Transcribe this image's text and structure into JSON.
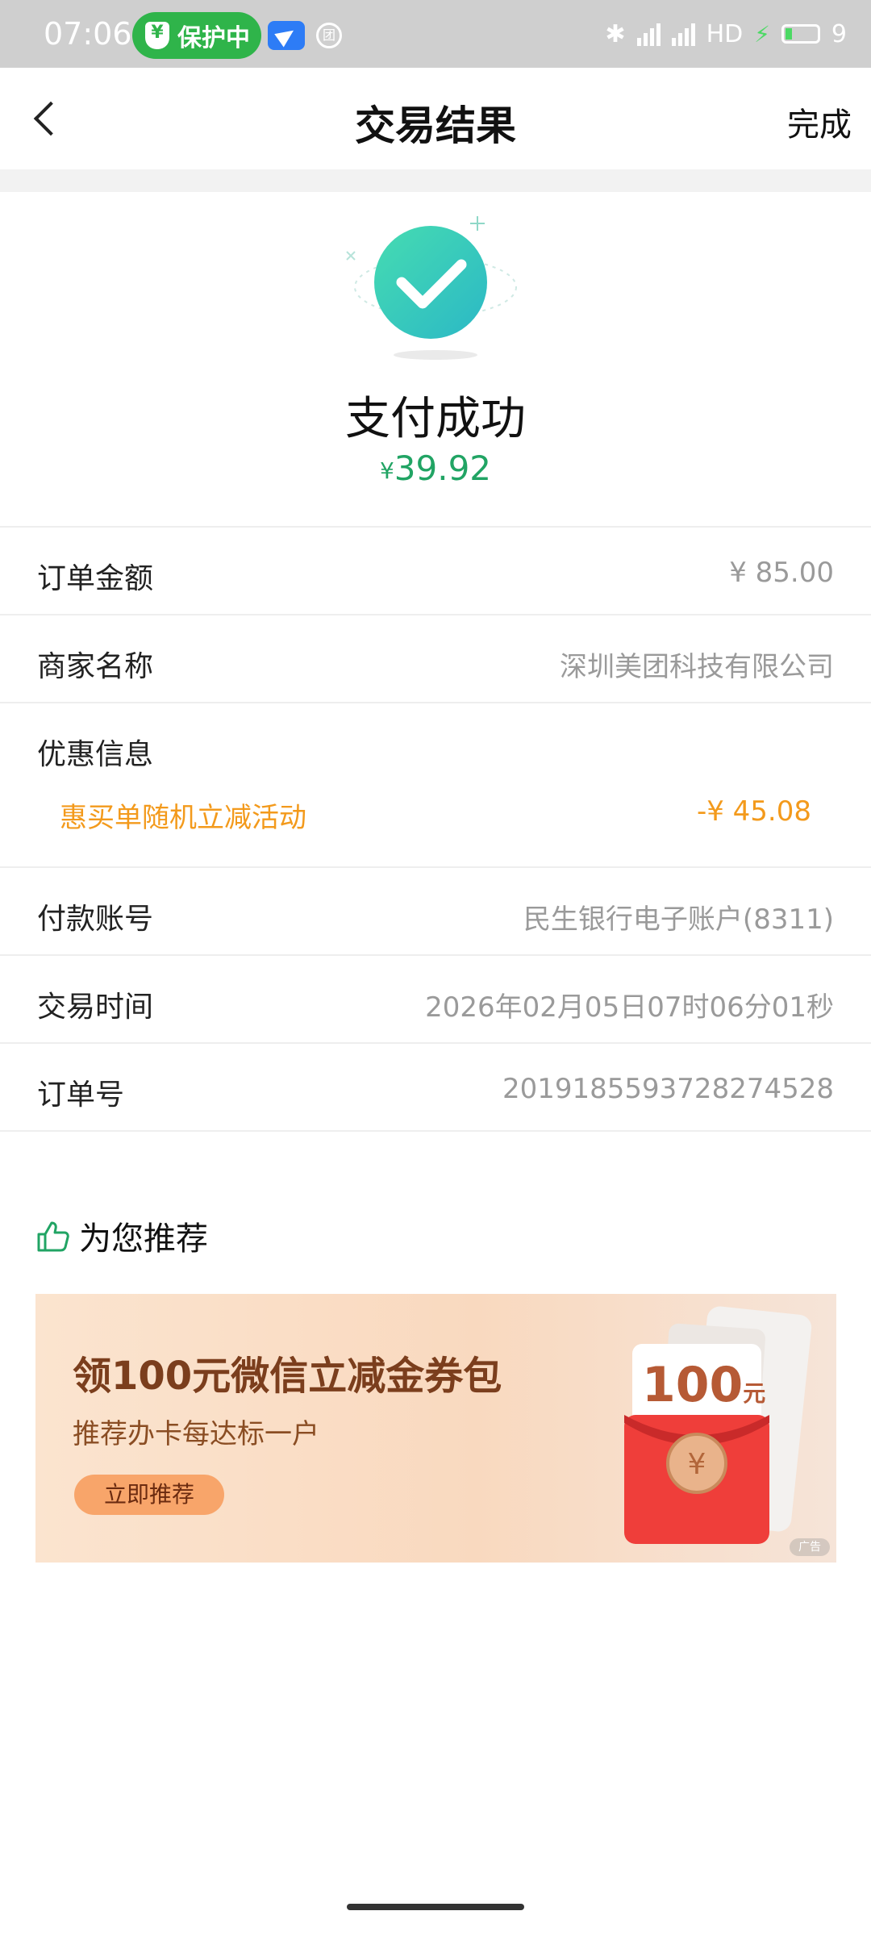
{
  "status_bar": {
    "time": "07:06",
    "protect_label": "保护中",
    "mt_badge": "团",
    "network": "HD",
    "battery_level": "9"
  },
  "header": {
    "title": "交易结果",
    "done_label": "完成"
  },
  "result": {
    "title": "支付成功",
    "currency": "¥",
    "amount": "39.92",
    "accent_color": "#21a464"
  },
  "details": {
    "order_amount": {
      "label": "订单金额",
      "value": "¥ 85.00"
    },
    "merchant": {
      "label": "商家名称",
      "value": "深圳美团科技有限公司"
    },
    "promo": {
      "label": "优惠信息",
      "name": "惠买单随机立减活动",
      "value": "-¥ 45.08"
    },
    "account": {
      "label": "付款账号",
      "value": "民生银行电子账户(8311)"
    },
    "time": {
      "label": "交易时间",
      "value": "2026年02月05日07时06分01秒"
    },
    "order_no": {
      "label": "订单号",
      "value": "2019185593728274528"
    }
  },
  "recommend": {
    "title": "为您推荐",
    "banner": {
      "title": "领100元微信立减金券包",
      "subtitle": "推荐办卡每达标一户",
      "button": "立即推荐",
      "card_value": "100",
      "card_unit": "元",
      "ad_label": "广告"
    }
  }
}
